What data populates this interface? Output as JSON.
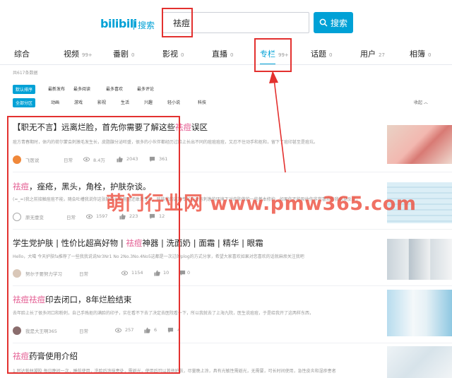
{
  "header": {
    "logo_text": "bilibili",
    "logo_sub": "搜索",
    "search_value": "祛痘",
    "search_button": "搜索"
  },
  "tabs": [
    {
      "label": "综合",
      "count": ""
    },
    {
      "label": "视频",
      "count": "99+"
    },
    {
      "label": "番剧",
      "count": "0"
    },
    {
      "label": "影视",
      "count": "0"
    },
    {
      "label": "直播",
      "count": "0"
    },
    {
      "label": "专栏",
      "count": "99+"
    },
    {
      "label": "话题",
      "count": "0"
    },
    {
      "label": "用户",
      "count": "27"
    },
    {
      "label": "相簿",
      "count": "0"
    }
  ],
  "result_count": "共617条数据",
  "sort_filters": [
    "默认排序",
    "最新发布",
    "最多阅读",
    "最多喜欢",
    "最多评论"
  ],
  "zone_filters": [
    "全部分区",
    "动画",
    "游戏",
    "影视",
    "生活",
    "兴趣",
    "轻小说",
    "科技"
  ],
  "collapse_label": "收起",
  "articles": [
    {
      "title_pre": "【职无不言】远离烂脸，首先你需要了解这些",
      "title_hl": "祛痘",
      "title_post": "误区",
      "desc": "痘方青春期时，体内的荷尔蒙会刺激毛发生长，皮脂腺分泌旺盛，很多的小伙伴都经历过脸上长出不同的痘痘痘痘，又忍不住动手和抠和，留下了痘印甚至是痘坑。",
      "author": "飞医说",
      "category": "日常",
      "views": "8.4万",
      "likes": "2043",
      "comments": "361"
    },
    {
      "title_pre": "",
      "title_hl": "祛痘",
      "title_post": "，痤疮，黑头，角栓，护肤杂谈。",
      "desc": "(=_=)我之前接触痘痘不能，随会吐槽我说你这张脸这么多痘痘还敢发专栏，咳咳我的这篇专栏在没有刺激的环境下对皮肤做的一些基本修护，如果你不能吸收你非常喜欢的我亲身反应，",
      "author": "原无壹变",
      "category": "日常",
      "views": "1597",
      "likes": "223",
      "comments": "12"
    },
    {
      "title_pre": "学生党护肤 | 性价比超高好物 | ",
      "title_hl": "祛痘",
      "title_post": "神器 | 洗面奶 | 面霜 | 精华 | 眼霜",
      "desc": "Hello，大噶 今天护肤fa推荐了一些我我说说Nr3Nr1 No 2No.3No.4No5这都是一次过的plog的方式分享，希望大家喜欢如果对您喜欢的话就麻烦关注我吧",
      "author": "努尔子要努力学习",
      "category": "日常",
      "views": "1154",
      "likes": "10",
      "comments": "0"
    },
    {
      "title_pre": "",
      "title_hl": "祛痘祛痘",
      "title_post": "印去闭口，8年烂脸结束",
      "desc": "去年脸上长了很多闭口和粉刺，自己手贱抠的满脸的印子，实在看不下去了决定去医院看一下，所以我就去了上海九院，医生说痘痘，于是给我开了这两样东西，",
      "author": "我是大王啊365",
      "category": "日常",
      "views": "257",
      "likes": "6",
      "comments": "4"
    },
    {
      "title_pre": "",
      "title_hl": "祛痘",
      "title_post": "药膏使用介绍",
      "desc": "1.阿达帕林凝胶 每日晚间一次，睡前使用，洗脸后涂抹患处，需避光，使用后可以其他护肤，尽量晚上涂，具有光敏性需避光，无需要，可长时间使用，急性皮炎和湿疹患者",
      "author": "",
      "category": "",
      "views": "",
      "likes": "",
      "comments": ""
    }
  ],
  "watermark": "萌门行业网 www.pmw365.com",
  "colors": {
    "accent": "#00a1d6",
    "keyword": "#e3588f",
    "annotation": "#e3312f"
  }
}
